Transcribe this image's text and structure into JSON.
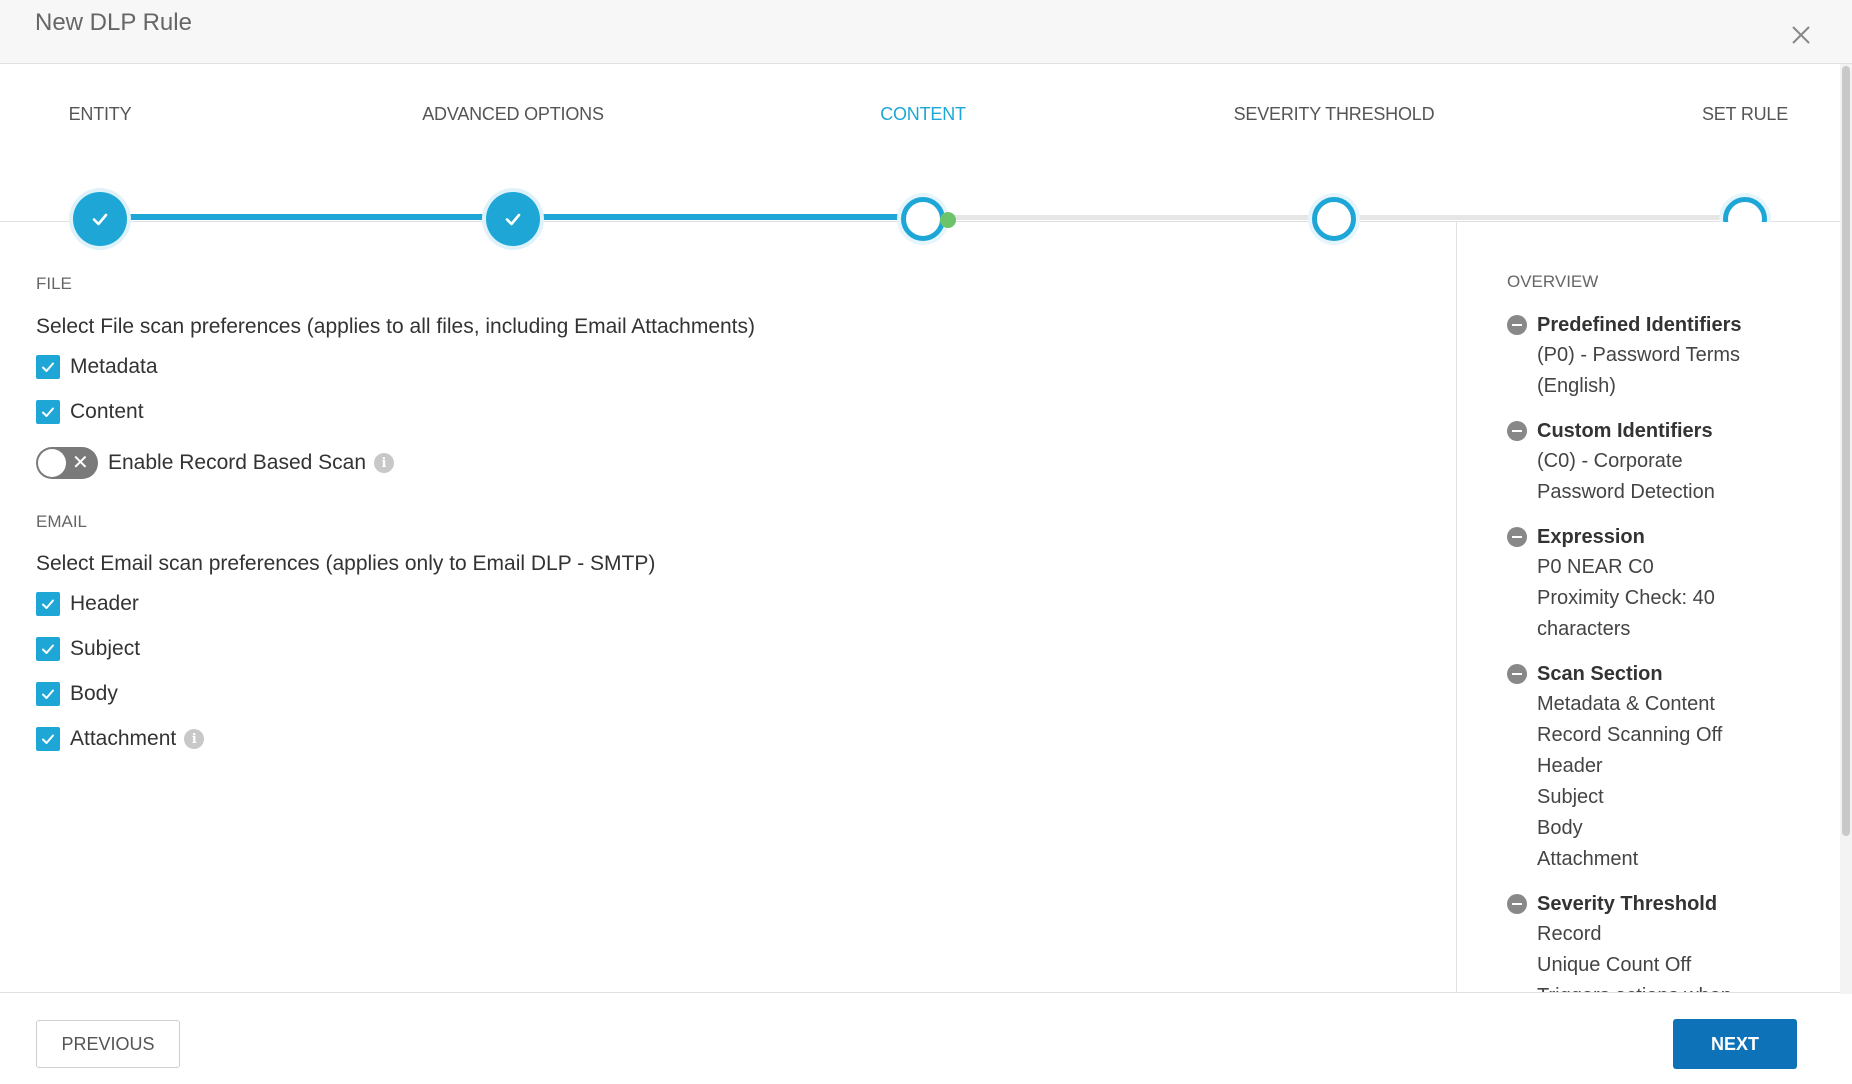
{
  "dialog": {
    "title": "New DLP Rule"
  },
  "stepper": {
    "steps": [
      {
        "label": "ENTITY",
        "state": "done"
      },
      {
        "label": "ADVANCED OPTIONS",
        "state": "done"
      },
      {
        "label": "CONTENT",
        "state": "active"
      },
      {
        "label": "SEVERITY THRESHOLD",
        "state": "pending"
      },
      {
        "label": "SET RULE",
        "state": "pending"
      }
    ]
  },
  "file": {
    "section_label": "FILE",
    "description": "Select File scan preferences (applies to all files, including Email Attachments)",
    "options": [
      {
        "label": "Metadata",
        "checked": true
      },
      {
        "label": "Content",
        "checked": true
      }
    ],
    "record_scan": {
      "label": "Enable Record Based Scan",
      "enabled": false
    }
  },
  "email": {
    "section_label": "EMAIL",
    "description": "Select Email scan preferences (applies only to Email DLP - SMTP)",
    "options": [
      {
        "label": "Header",
        "checked": true
      },
      {
        "label": "Subject",
        "checked": true
      },
      {
        "label": "Body",
        "checked": true
      },
      {
        "label": "Attachment",
        "checked": true
      }
    ]
  },
  "overview": {
    "title": "OVERVIEW",
    "items": [
      {
        "heading": "Predefined Identifiers",
        "lines": [
          "(P0) - Password Terms",
          "(English)"
        ]
      },
      {
        "heading": "Custom Identifiers",
        "lines": [
          "(C0) - Corporate",
          "Password Detection"
        ]
      },
      {
        "heading": "Expression",
        "lines": [
          "P0 NEAR C0",
          "Proximity Check: 40",
          "characters"
        ]
      },
      {
        "heading": "Scan Section",
        "lines": [
          "Metadata & Content",
          "Record Scanning Off",
          "Header",
          "Subject",
          "Body",
          "Attachment"
        ]
      },
      {
        "heading": "Severity Threshold",
        "lines": [
          "Record",
          "Unique Count Off",
          "Triggers actions when"
        ]
      }
    ]
  },
  "footer": {
    "previous_label": "PREVIOUS",
    "next_label": "NEXT"
  },
  "colors": {
    "accent": "#1ea7d6",
    "primary_button": "#0d72b8",
    "progress_dot": "#6cc36a"
  }
}
